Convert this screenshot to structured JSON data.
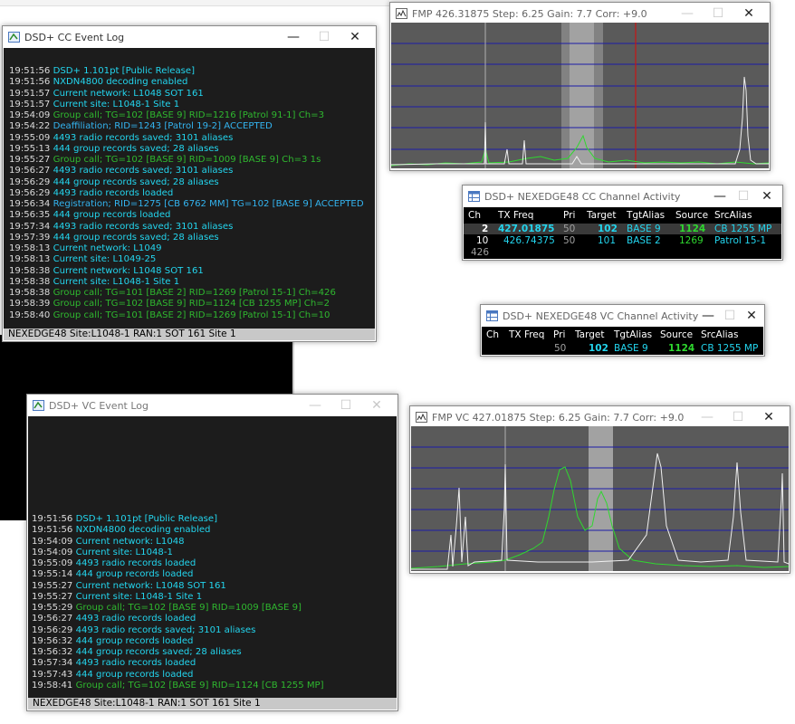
{
  "cc_log": {
    "title": "DSD+ CC Event Log",
    "lines": [
      {
        "t": "19:51:56",
        "m": "DSD+ 1.101pt  [Public Release]",
        "c": "cyan"
      },
      {
        "t": "19:51:56",
        "m": "NXDN4800 decoding enabled",
        "c": "cyan"
      },
      {
        "t": "19:51:57",
        "m": "Current network:  L1048   SOT 161",
        "c": "cyan"
      },
      {
        "t": "19:51:57",
        "m": "Current site:  L1048-1  Site 1",
        "c": "cyan"
      },
      {
        "t": "19:54:09",
        "m": "Group call; TG=102 [BASE 9]  RID=1216 [Patrol 91-1]  Ch=3",
        "c": "green"
      },
      {
        "t": "19:54:22",
        "m": "Deaffiliation; RID=1243 [Patrol 19-2]    ACCEPTED",
        "c": "blue"
      },
      {
        "t": "19:55:09",
        "m": "4493 radio records saved; 3101 aliases",
        "c": "cyan"
      },
      {
        "t": "19:55:13",
        "m": "444 group records saved; 28 aliases",
        "c": "cyan"
      },
      {
        "t": "19:55:27",
        "m": "Group call; TG=102 [BASE 9]  RID=1009 [BASE 9]  Ch=3  1s",
        "c": "green"
      },
      {
        "t": "19:56:27",
        "m": "4493 radio records saved; 3101 aliases",
        "c": "cyan"
      },
      {
        "t": "19:56:29",
        "m": "444 group records saved; 28 aliases",
        "c": "cyan"
      },
      {
        "t": "19:56:29",
        "m": "4493 radio records loaded",
        "c": "cyan"
      },
      {
        "t": "19:56:34",
        "m": "Registration; RID=1275 [CB 6762 MM]  TG=102 [BASE 9]    ACCEPTED",
        "c": "blue"
      },
      {
        "t": "19:56:35",
        "m": "444 group records loaded",
        "c": "cyan"
      },
      {
        "t": "19:57:34",
        "m": "4493 radio records saved; 3101 aliases",
        "c": "cyan"
      },
      {
        "t": "19:57:39",
        "m": "444 group records saved; 28 aliases",
        "c": "cyan"
      },
      {
        "t": "19:58:13",
        "m": "Current network:  L1049",
        "c": "cyan"
      },
      {
        "t": "19:58:13",
        "m": "Current site:  L1049-25",
        "c": "cyan"
      },
      {
        "t": "19:58:38",
        "m": "Current network:  L1048   SOT 161",
        "c": "cyan"
      },
      {
        "t": "19:58:38",
        "m": "Current site:  L1048-1  Site 1",
        "c": "cyan"
      },
      {
        "t": "19:58:38",
        "m": "Group call; TG=101 [BASE 2]  RID=1269 [Patrol 15-1]  Ch=426",
        "c": "green"
      },
      {
        "t": "19:58:39",
        "m": "Group call; TG=102 [BASE 9]  RID=1124 [CB 1255 MP]  Ch=2",
        "c": "green"
      },
      {
        "t": "19:58:40",
        "m": "Group call; TG=101 [BASE 2]  RID=1269 [Patrol 15-1]  Ch=10",
        "c": "green"
      }
    ],
    "status": "NEXEDGE48  Site:L1048-1  RAN:1    SOT 161  Site 1"
  },
  "vc_log": {
    "title": "DSD+ VC Event Log",
    "lines": [
      {
        "t": "19:51:56",
        "m": "DSD+ 1.101pt  [Public Release]",
        "c": "cyan"
      },
      {
        "t": "19:51:56",
        "m": "NXDN4800 decoding enabled",
        "c": "cyan"
      },
      {
        "t": "19:54:09",
        "m": "Current network:  L1048",
        "c": "cyan"
      },
      {
        "t": "19:54:09",
        "m": "Current site:  L1048-1",
        "c": "cyan"
      },
      {
        "t": "19:55:09",
        "m": "4493 radio records loaded",
        "c": "cyan"
      },
      {
        "t": "19:55:14",
        "m": "444 group records loaded",
        "c": "cyan"
      },
      {
        "t": "19:55:27",
        "m": "Current network:  L1048   SOT 161",
        "c": "cyan"
      },
      {
        "t": "19:55:27",
        "m": "Current site:  L1048-1  Site 1",
        "c": "cyan"
      },
      {
        "t": "19:55:29",
        "m": "Group call; TG=102 [BASE 9]  RID=1009 [BASE 9]",
        "c": "green"
      },
      {
        "t": "19:56:27",
        "m": "4493 radio records loaded",
        "c": "cyan"
      },
      {
        "t": "19:56:29",
        "m": "4493 radio records saved; 3101 aliases",
        "c": "cyan"
      },
      {
        "t": "19:56:32",
        "m": "444 group records loaded",
        "c": "cyan"
      },
      {
        "t": "19:56:32",
        "m": "444 group records saved; 28 aliases",
        "c": "cyan"
      },
      {
        "t": "19:57:34",
        "m": "4493 radio records loaded",
        "c": "cyan"
      },
      {
        "t": "19:57:43",
        "m": "444 group records loaded",
        "c": "cyan"
      },
      {
        "t": "19:58:41",
        "m": "Group call; TG=102 [BASE 9]  RID=1124 [CB 1255 MP]",
        "c": "green"
      }
    ],
    "status": "NEXEDGE48  Site:L1048-1  RAN:1    SOT 161  Site 1"
  },
  "fmp_cc": {
    "title": "FMP   426.31875   Step: 6.25   Gain: 7.7   Corr: +9.0"
  },
  "fmp_vc": {
    "title": "FMP   VC   427.01875   Step: 6.25   Gain: 7.7   Corr: +9.0"
  },
  "cc_activity": {
    "title": "DSD+ NEXEDGE48 CC Channel Activity",
    "headers": [
      "Ch",
      "TX Freq",
      "Pri",
      "Target",
      "TgtAlias",
      "Source",
      "SrcAlias"
    ],
    "rows": [
      {
        "ch": "2",
        "freq": "427.01875",
        "pri": "50",
        "target": "102",
        "tgtalias": "BASE 9",
        "source": "1124",
        "srcalias": "CB 1255 MP"
      },
      {
        "ch": "10",
        "freq": "426.74375",
        "pri": "50",
        "target": "101",
        "tgtalias": "BASE 2",
        "source": "1269",
        "srcalias": "Patrol 15-1"
      },
      {
        "ch": "426",
        "freq": "",
        "pri": "",
        "target": "",
        "tgtalias": "",
        "source": "",
        "srcalias": ""
      }
    ]
  },
  "vc_activity": {
    "title": "DSD+ NEXEDGE48 VC Channel Activity",
    "headers": [
      "Ch",
      "TX Freq",
      "Pri",
      "Target",
      "TgtAlias",
      "Source",
      "SrcAlias"
    ],
    "rows": [
      {
        "ch": "",
        "freq": "",
        "pri": "50",
        "target": "102",
        "tgtalias": "BASE 9",
        "source": "1124",
        "srcalias": "CB 1255 MP"
      }
    ]
  },
  "controls": {
    "minimize": "—",
    "maximize": "☐",
    "close": "✕"
  },
  "colors": {
    "cyan": "#23d5ee",
    "green": "#2fb82f",
    "blue": "#33b4f0",
    "spectrum_bg": "#5a5a5a",
    "grid_line": "#1c1ca8",
    "marker": "#c81414"
  }
}
